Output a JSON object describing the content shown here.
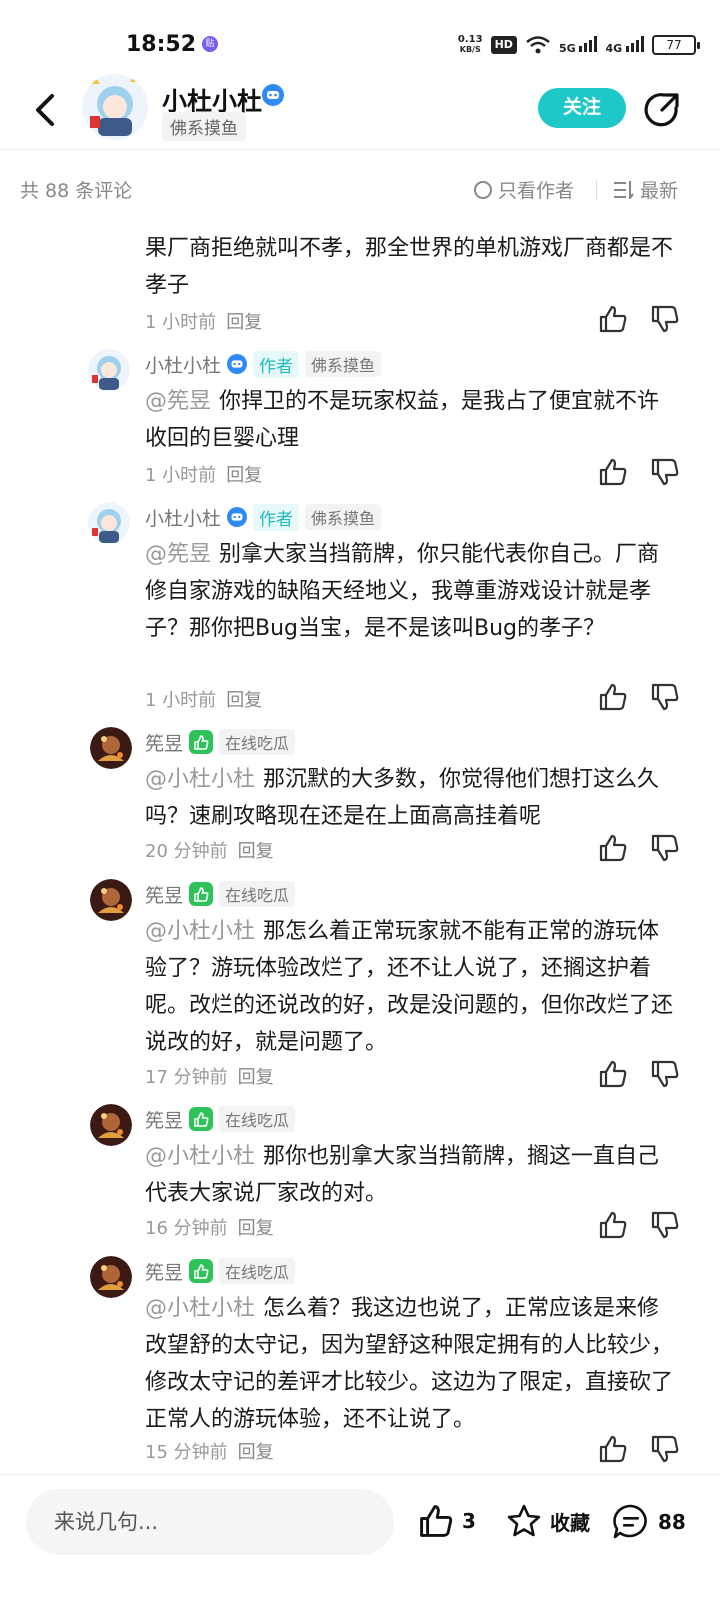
{
  "status_bar": {
    "time": "18:52",
    "app_dot": "贴",
    "speed_top": "0.13",
    "speed_bottom": "KB/S",
    "hd": "HD",
    "net1": "5G",
    "net2": "4G",
    "battery": "77"
  },
  "header": {
    "name": "小杜小杜",
    "tag": "佛系摸鱼",
    "follow_label": "关注"
  },
  "count_bar": {
    "count_text": "共 88 条评论",
    "only_author": "只看作者",
    "latest": "最新"
  },
  "comments": [
    {
      "body": "果厂商拒绝就叫不孝，那全世界的单机游戏厂商都是不孝子",
      "time": "1 小时前",
      "reply": "回复"
    },
    {
      "name": "小杜小杜",
      "role": "作者",
      "tag": "佛系摸鱼",
      "at": "@筅昱",
      "body": "你捍卫的不是玩家权益，是我占了便宜就不许收回的巨婴心理",
      "time": "1 小时前",
      "reply": "回复"
    },
    {
      "name": "小杜小杜",
      "role": "作者",
      "tag": "佛系摸鱼",
      "at": "@筅昱",
      "body": "别拿大家当挡箭牌，你只能代表你自己。厂商修自家游戏的缺陷天经地义，我尊重游戏设计就是孝子？那你把Bug当宝，是不是该叫Bug的孝子？",
      "time": "1 小时前",
      "reply": "回复"
    },
    {
      "name": "筅昱",
      "tag": "在线吃瓜",
      "at": "@小杜小杜",
      "body": "那沉默的大多数，你觉得他们想打这么久吗？速刷攻略现在还是在上面高高挂着呢",
      "time": "20 分钟前",
      "reply": "回复"
    },
    {
      "name": "筅昱",
      "tag": "在线吃瓜",
      "at": "@小杜小杜",
      "body": "那怎么着正常玩家就不能有正常的游玩体验了？游玩体验改烂了，还不让人说了，还搁这护着呢。改烂的还说改的好，改是没问题的，但你改烂了还说改的好，就是问题了。",
      "time": "17 分钟前",
      "reply": "回复"
    },
    {
      "name": "筅昱",
      "tag": "在线吃瓜",
      "at": "@小杜小杜",
      "body": "那你也别拿大家当挡箭牌，搁这一直自己代表大家说厂家改的对。",
      "time": "16 分钟前",
      "reply": "回复"
    },
    {
      "name": "筅昱",
      "tag": "在线吃瓜",
      "at": "@小杜小杜",
      "body": "怎么着？我这边也说了，正常应该是来修改望舒的太守记，因为望舒这种限定拥有的人比较少，修改太守记的差评才比较少。这边为了限定，直接砍了正常人的游玩体验，还不让说了。",
      "time": "15 分钟前",
      "reply": "回复"
    }
  ],
  "bottom_bar": {
    "input_placeholder": "来说几句...",
    "like_count": "3",
    "fav_label": "收藏",
    "comment_count": "88"
  },
  "colors": {
    "accent": "#1ec8c8",
    "badge_blue": "#2f8af5",
    "badge_green": "#2fc25b"
  }
}
